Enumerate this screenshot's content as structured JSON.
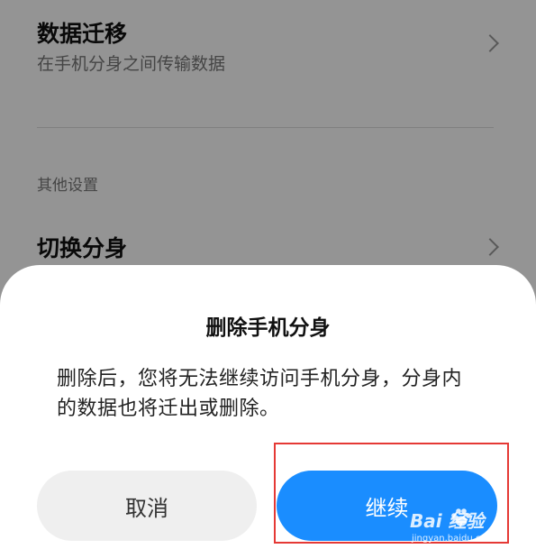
{
  "background_page": {
    "data_migration": {
      "title": "数据迁移",
      "subtitle": "在手机分身之间传输数据"
    },
    "section_other": "其他设置",
    "switch_profile": {
      "title": "切换分身"
    }
  },
  "dialog": {
    "title": "删除手机分身",
    "message": "删除后，您将无法继续访问手机分身，分身内的数据也将迁出或删除。",
    "cancel_label": "取消",
    "continue_label": "继续"
  },
  "watermark": {
    "brand": "Bai  经验",
    "subtitle": "jingyan.baidu.com"
  },
  "colors": {
    "accent": "#1a8dff",
    "highlight": "#e53935"
  }
}
